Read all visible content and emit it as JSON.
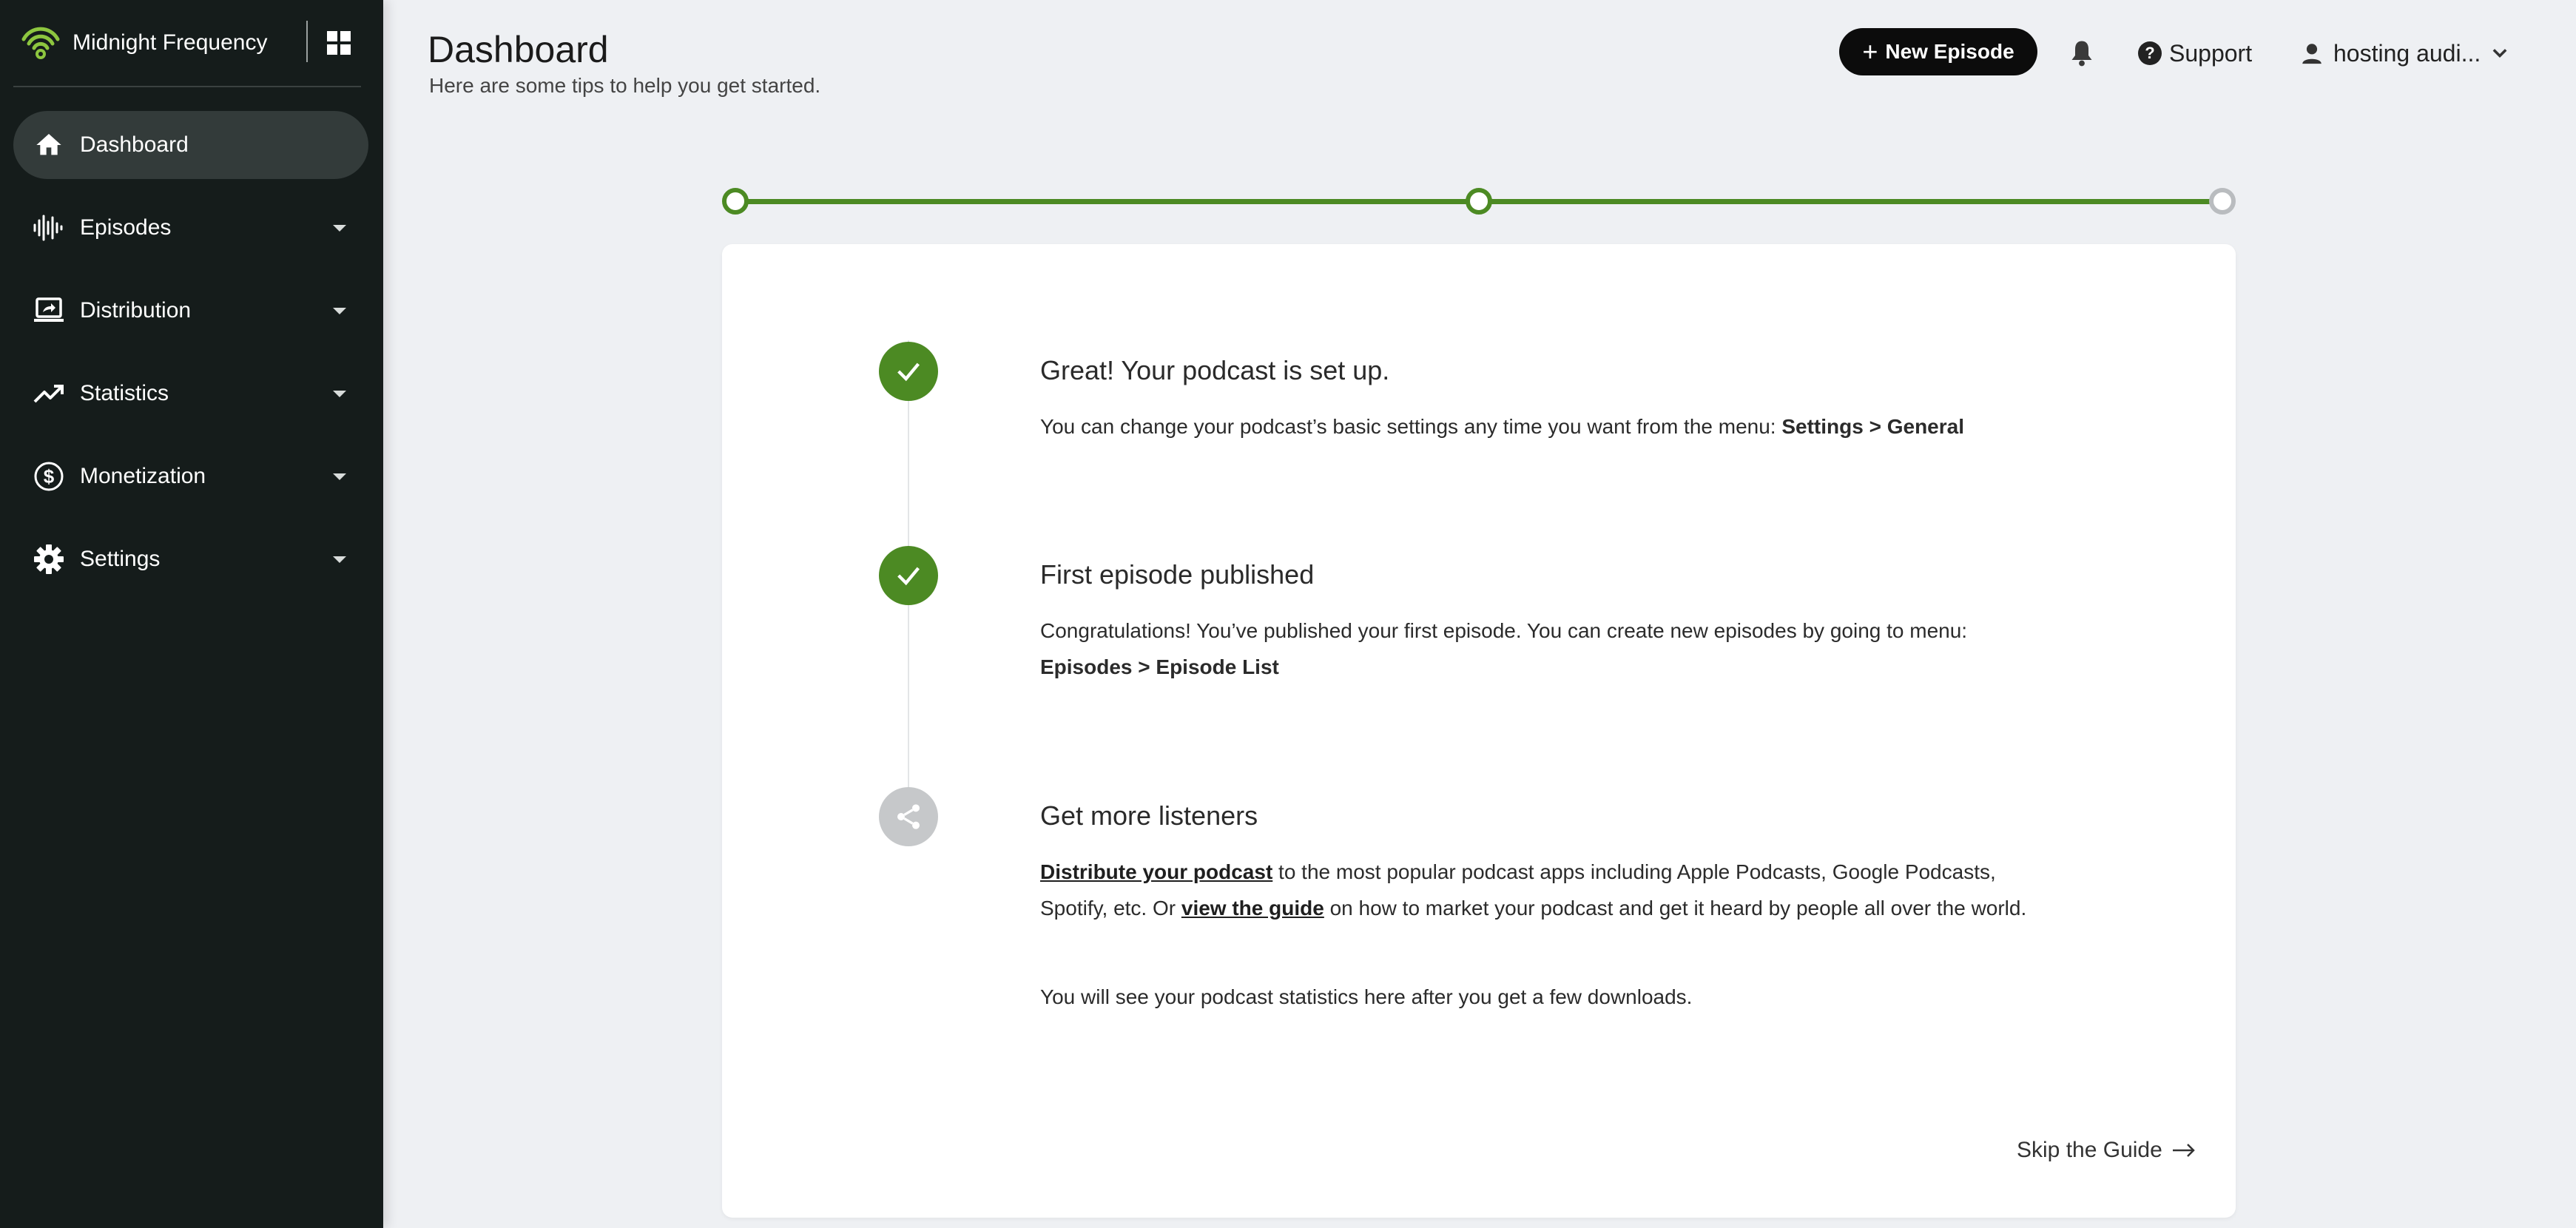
{
  "brand": {
    "name": "Midnight Frequency",
    "accent": "#8dc63f"
  },
  "sidebar": {
    "items": [
      {
        "label": "Dashboard",
        "icon": "home-icon",
        "active": true,
        "has_caret": false
      },
      {
        "label": "Episodes",
        "icon": "audio-wave-icon",
        "has_caret": true
      },
      {
        "label": "Distribution",
        "icon": "laptop-share-icon",
        "has_caret": true
      },
      {
        "label": "Statistics",
        "icon": "trending-up-icon",
        "has_caret": true
      },
      {
        "label": "Monetization",
        "icon": "dollar-circle-icon",
        "has_caret": true
      },
      {
        "label": "Settings",
        "icon": "gear-icon",
        "has_caret": true
      }
    ]
  },
  "header": {
    "title": "Dashboard",
    "subtitle": "Here are some tips to help you get started.",
    "new_episode": "New Episode",
    "support": "Support",
    "account": "hosting audi..."
  },
  "progress": {
    "steps_complete": 2,
    "steps_total": 3,
    "color": "#4c8a23"
  },
  "guide": {
    "step1": {
      "title": "Great! Your podcast is set up.",
      "text": "You can change your podcast’s basic settings any time you want from the menu: ",
      "path": "Settings > General"
    },
    "step2": {
      "title": "First episode published",
      "text": "Congratulations! You’ve published your first episode. You can create new episodes by going to menu:",
      "path": "Episodes > Episode List"
    },
    "step3": {
      "title": "Get more listeners",
      "link1": "Distribute your podcast",
      "text1": " to the most popular podcast apps including Apple Podcasts, Google Podcasts, Spotify, etc. Or ",
      "link2": "view the guide",
      "text2": " on how to market your podcast and get it heard by people all over the world."
    },
    "stats_note": "You will see your podcast statistics here after you get a few downloads.",
    "skip": "Skip the Guide"
  }
}
